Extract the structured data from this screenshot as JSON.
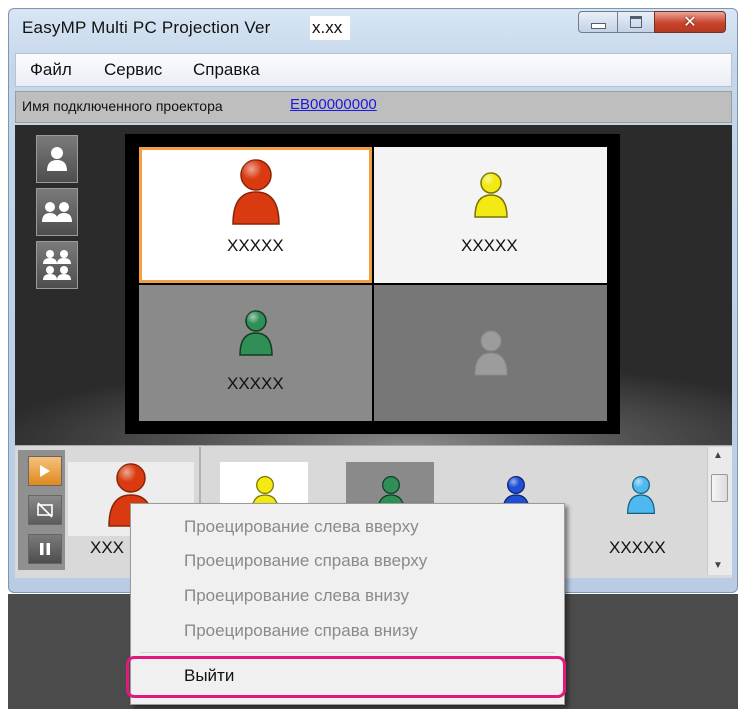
{
  "window": {
    "title_prefix": "EasyMP Multi PC Projection Ver",
    "title_version": "x.xx",
    "minimize_icon": "minimize-icon",
    "maximize_icon": "maximize-icon",
    "close_icon": "close-icon"
  },
  "menu": [
    "Файл",
    "Сервис",
    "Справка"
  ],
  "connection": {
    "label": "Имя подключенного проектора",
    "projector": "EB00000000"
  },
  "layout_buttons": [
    "single-user-icon",
    "two-users-icon",
    "four-users-icon"
  ],
  "screen": {
    "top_left": {
      "label": "XXXXX",
      "color": "#d93a10"
    },
    "top_right": {
      "label": "XXXXX",
      "color": "#f2ea12"
    },
    "bottom_left": {
      "label": "XXXXX",
      "color": "#2f8f57"
    },
    "bottom_right": {
      "label": "",
      "color": "#9c9c9c"
    }
  },
  "controls": [
    "play-icon",
    "hide-icon",
    "pause-icon"
  ],
  "thumbnails": [
    {
      "label": "XXX",
      "color": "#d93a10"
    },
    {
      "label": "",
      "color": "#f2ea12"
    },
    {
      "label": "",
      "color": "#2f8f57"
    },
    {
      "label": "",
      "color": "#1f4fd6"
    },
    {
      "label": "XXXXX",
      "color": "#4fb9ef"
    }
  ],
  "context_menu": {
    "items": [
      "Проецирование слева вверху",
      "Проецирование справа вверху",
      "Проецирование слева внизу",
      "Проецирование справа внизу"
    ],
    "exit": "Выйти"
  },
  "colors": {
    "highlight": "#e2197c",
    "selected_border": "#f0a040"
  }
}
